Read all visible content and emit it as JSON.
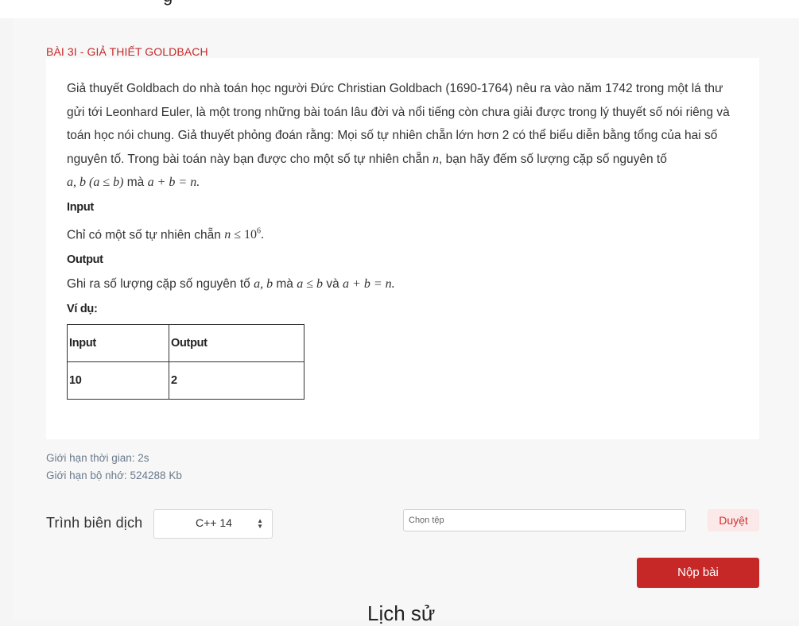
{
  "top_partial_text": "g",
  "problem": {
    "title": "BÀI 3I - GIẢ THIẾT GOLDBACH",
    "statement": {
      "p1_text": "Giả thuyết Goldbach do nhà toán học người Đức Christian Goldbach (1690-1764) nêu ra vào năm 1742 trong một lá thư gửi tới Leonhard Euler, là một trong những bài toán lâu đời và nổi tiếng còn chưa giải được trong lý thuyết số nói riêng và toán học nói chung. Giả thuyết phỏng đoán rằng: Mọi số tự nhiên chẵn lớn hơn 2 có thể biểu diễn bằng tổng của hai số nguyên tố. Trong bài toán này bạn được cho một số tự nhiên chẵn ",
      "p1_var_n": "n",
      "p1_text2": ", bạn hãy đếm số lượng cặp số nguyên tố ",
      "p1_vars_ab": "a, b (a ≤ b)",
      "p1_text3": " mà ",
      "p1_eq": "a + b = n.",
      "input_heading": "Input",
      "input_text": "Chỉ có một số tự nhiên chẵn ",
      "input_math_n": "n ≤ ",
      "input_math_base": "10",
      "input_math_exp": "6",
      "input_math_end": ".",
      "output_heading": "Output",
      "output_text": "Ghi ra số lượng cặp số nguyên tố ",
      "output_vars": "a, b",
      "output_text2": " mà ",
      "output_cond": "a ≤ b",
      "output_text3": " và ",
      "output_eq": "a + b = n.",
      "example_heading": "Ví dụ:",
      "example_table": {
        "headers": [
          "Input",
          "Output"
        ],
        "rows": [
          [
            "10",
            "2"
          ]
        ]
      }
    },
    "limits": {
      "time": "Giới hạn thời gian: 2s",
      "memory": "Giới hạn bộ nhớ: 524288 Kb"
    }
  },
  "submit_form": {
    "compiler_label": "Trình biên dịch",
    "compiler_selected": "C++ 14",
    "file_placeholder": "Chọn tệp",
    "browse_label": "Duyệt",
    "submit_label": "Nộp bài"
  },
  "history_heading": "Lịch sử",
  "colors": {
    "accent": "#c62828",
    "browse_bg": "#fbe9e9",
    "muted_text": "#6b7a8d"
  }
}
